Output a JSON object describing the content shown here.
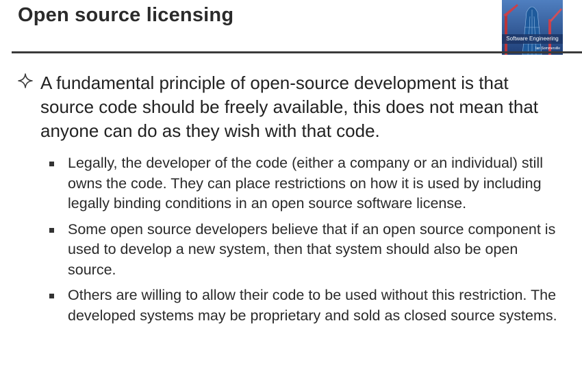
{
  "slide": {
    "title": "Open source licensing",
    "logo": {
      "text": "Software Engineering",
      "subtext": "Ian Sommerville"
    },
    "main_point": "A fundamental principle of open-source development is that source code should be freely available, this does not mean that anyone can do as they wish with that code.",
    "sub_points": [
      "Legally, the developer of the code (either a company or an individual) still owns the code. They can place restrictions on how it is used by including legally binding conditions in an open source software license.",
      "Some open source developers believe that if an open source component is used to develop a new system, then that system should also be open source.",
      "Others are willing to allow their code to be used without this restriction. The developed systems may be proprietary and sold as closed source systems."
    ]
  }
}
